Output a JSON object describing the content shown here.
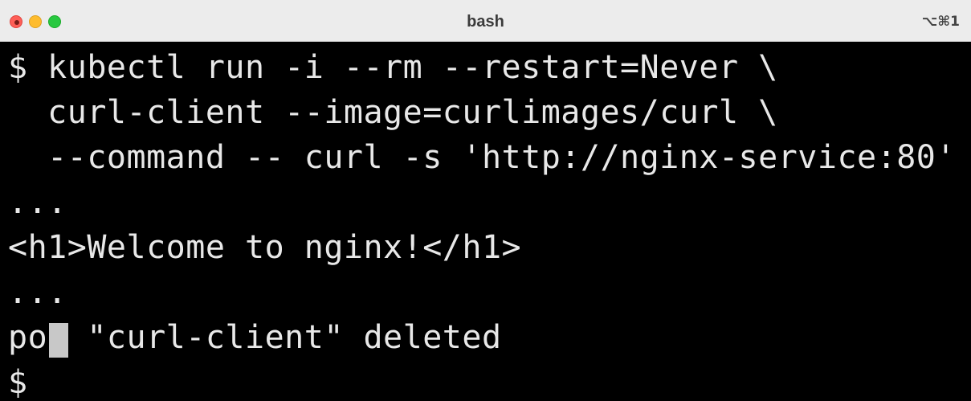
{
  "window": {
    "title": "bash",
    "shortcut": "⌥⌘1",
    "traffic_lights": {
      "close_color": "#fe5f57",
      "minimize_color": "#febc2e",
      "maximize_color": "#28c840"
    }
  },
  "terminal": {
    "background": "#000000",
    "foreground": "#e8e8e8",
    "cursor_color": "#c8c8c8",
    "lines": [
      "$ kubectl run -i --rm --restart=Never \\",
      "  curl-client --image=curlimages/curl \\",
      "  --command -- curl -s 'http://nginx-service:80'",
      "...",
      "<h1>Welcome to nginx!</h1>",
      "...",
      "pod \"curl-client\" deleted",
      "$"
    ]
  }
}
